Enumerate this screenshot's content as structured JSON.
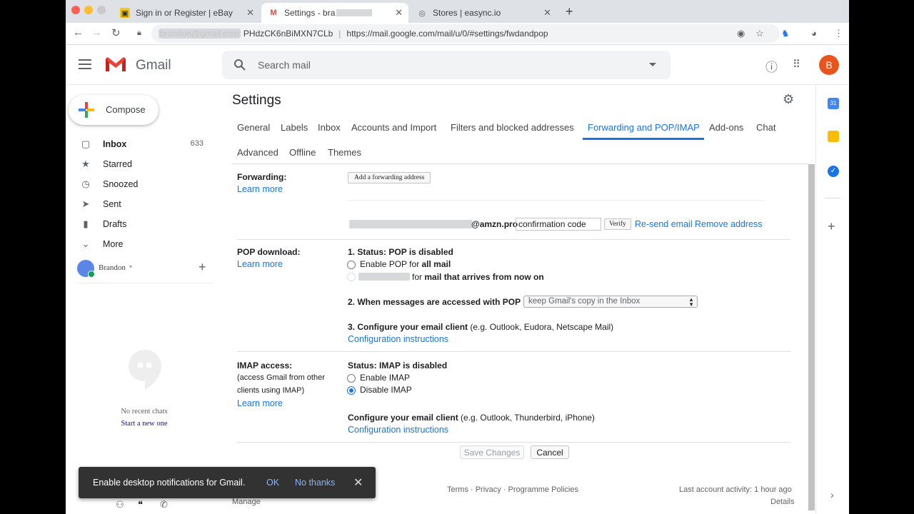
{
  "browser": {
    "tabs": [
      {
        "label": "Sign in or Register | eBay"
      },
      {
        "label": "Settings - bra"
      },
      {
        "label": "Stores | easync.io"
      }
    ],
    "address": {
      "account_fragment": "PHdzCK6nBiMXN7CLb",
      "url": "https://mail.google.com/mail/u/0/#settings/fwdandpop"
    }
  },
  "header": {
    "app_name": "Gmail",
    "search_placeholder": "Search mail",
    "avatar_letter": "B"
  },
  "sidebar": {
    "compose_label": "Compose",
    "items": [
      {
        "label": "Inbox",
        "count": "633"
      },
      {
        "label": "Starred"
      },
      {
        "label": "Snoozed"
      },
      {
        "label": "Sent"
      },
      {
        "label": "Drafts"
      },
      {
        "label": "More"
      }
    ],
    "user_name": "Brandon",
    "no_chats": "No recent chats",
    "start_new": "Start a new one"
  },
  "settings": {
    "title": "Settings",
    "tabs": [
      "General",
      "Labels",
      "Inbox",
      "Accounts and Import",
      "Filters and blocked addresses",
      "Forwarding and POP/IMAP",
      "Add-ons",
      "Chat",
      "Advanced",
      "Offline",
      "Themes"
    ],
    "active_tab": "Forwarding and POP/IMAP",
    "learn_more": "Learn more",
    "forwarding": {
      "label": "Forwarding:",
      "add_button": "Add a forwarding address",
      "email_suffix": "@amzn.pro",
      "code_value": "confirmation code",
      "verify_button": "Verify",
      "resend_link": "Re-send email",
      "remove_link": "Remove address"
    },
    "pop": {
      "label": "POP download:",
      "status_prefix": "1. Status: ",
      "status_value": "POP is disabled",
      "opt1_prefix": "Enable POP for ",
      "opt1_value": "all mail",
      "opt2_mid": "for ",
      "opt2_value": "mail that arrives from now on",
      "when_label": "2. When messages are accessed with POP",
      "when_select": "keep Gmail's copy in the Inbox",
      "configure_label": "3. Configure your email client",
      "configure_hint": " (e.g. Outlook, Eudora, Netscape Mail)",
      "config_link": "Configuration instructions"
    },
    "imap": {
      "label": "IMAP access:",
      "sublabel_1": "(access Gmail from other",
      "sublabel_2": "clients using IMAP)",
      "status": "Status: IMAP is disabled",
      "enable": "Enable IMAP",
      "disable": "Disable IMAP",
      "configure_label": "Configure your email client",
      "configure_hint": " (e.g. Outlook, Thunderbird, iPhone)",
      "config_link": "Configuration instructions"
    },
    "save_button": "Save Changes",
    "cancel_button": "Cancel"
  },
  "footer": {
    "links": "Terms · Privacy · Programme Policies",
    "last_activity": "Last account activity: 1 hour ago",
    "details": "Details",
    "manage": "Manage"
  },
  "toast": {
    "message": "Enable desktop notifications for Gmail.",
    "ok": "OK",
    "no_thanks": "No thanks"
  },
  "colors": {
    "accent": "#1a73e8",
    "avatar": "#e8541b",
    "gmail_red": "#ea4335"
  }
}
